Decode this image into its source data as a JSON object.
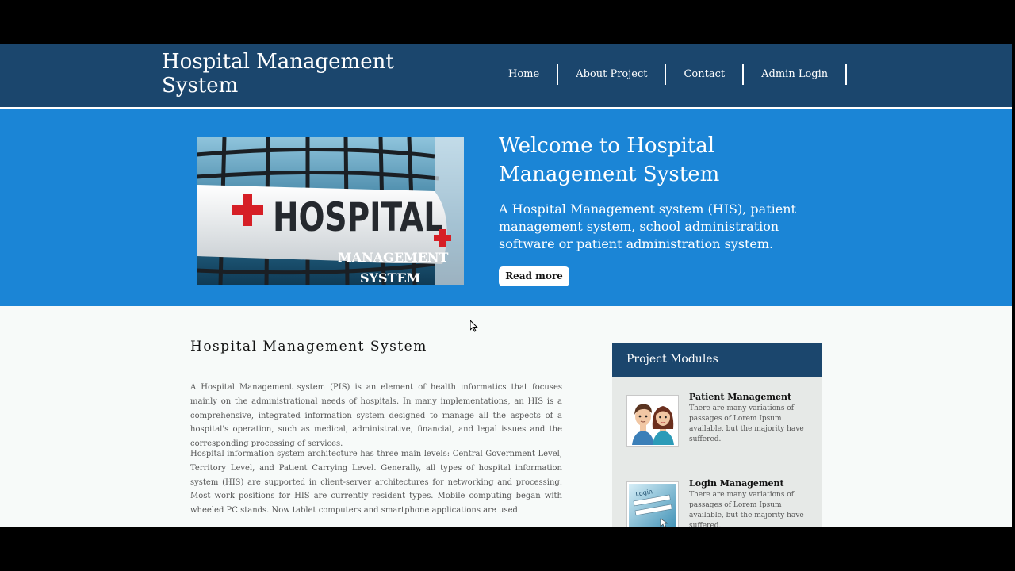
{
  "header": {
    "logo": "Hospital Management System",
    "nav": [
      "Home",
      "About Project",
      "Contact",
      "Admin Login"
    ]
  },
  "hero": {
    "title": "Welcome to Hospital Management System",
    "description": "A Hospital Management system (HIS), patient management system, school administration software or patient administration system.",
    "button_label": "Read more",
    "image_text": {
      "sign": "HOSPITAL",
      "line1": "MANAGEMENT",
      "line2": "SYSTEM"
    }
  },
  "main": {
    "title": "Hospital Management System",
    "paragraphs": [
      "A Hospital Management system (PIS) is an element of health informatics that focuses mainly on the administrational needs of hospitals. In many implementations, an HIS is a comprehensive, integrated information system designed to manage all the aspects of a hospital's operation, such as medical, administrative, financial, and legal issues and the corresponding processing of services.",
      "Hospital information system architecture has three main levels: Central Government Level, Territory Level, and Patient Carrying Level. Generally, all types of hospital information system (HIS) are supported in client-server architectures for networking and processing. Most work positions for HIS are currently resident types. Mobile computing began with wheeled PC stands. Now tablet computers and smartphone applications are used."
    ]
  },
  "sidebar": {
    "title": "Project Modules",
    "modules": [
      {
        "title": "Patient Management",
        "text": "There are many variations of passages of Lorem Ipsum available, but the majority have suffered."
      },
      {
        "title": "Login Management",
        "text": "There are many variations of passages of Lorem Ipsum available, but the majority have suffered.",
        "thumb_text": "Login"
      }
    ]
  },
  "colors": {
    "header_bg": "#1b466d",
    "hero_bg": "#1b85d6",
    "page_bg": "#f7faf9",
    "sidebar_bg": "#e6e9e7"
  }
}
